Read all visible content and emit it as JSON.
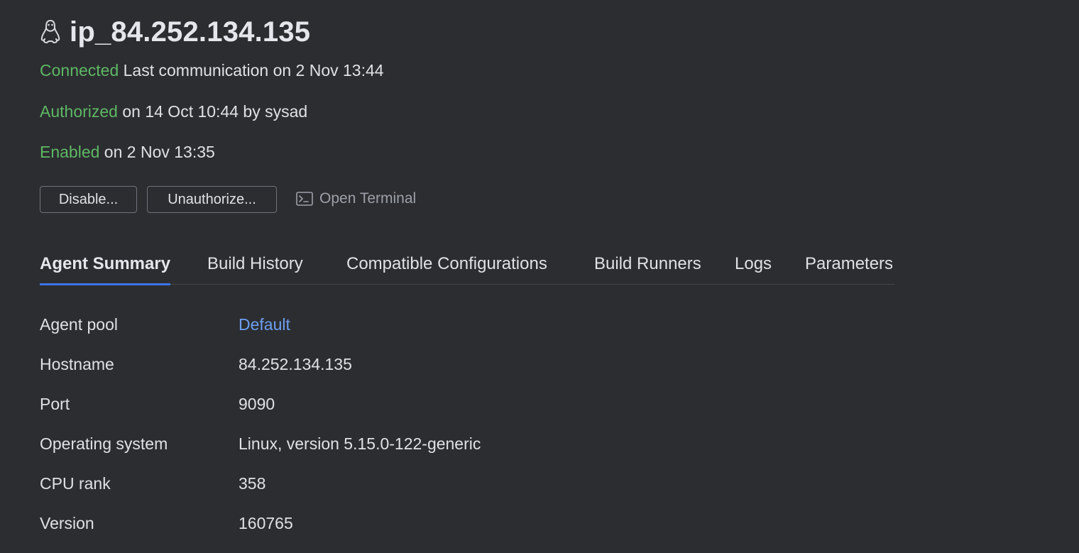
{
  "agent": {
    "title": "ip_84.252.134.135",
    "os_icon": "linux-tux-icon"
  },
  "status": {
    "connected_label": "Connected",
    "connected_text": " Last communication on 2 Nov 13:44",
    "authorized_label": "Authorized",
    "authorized_text": " on 14 Oct 10:44 by sysad",
    "enabled_label": "Enabled",
    "enabled_text": " on 2 Nov 13:35",
    "ok_color": "#5fb865"
  },
  "actions": {
    "disable_label": "Disable...",
    "unauthorize_label": "Unauthorize...",
    "terminal_label": "Open Terminal",
    "terminal_icon": "terminal-icon"
  },
  "tabs": [
    {
      "label": "Agent Summary",
      "active": true
    },
    {
      "label": "Build History",
      "active": false
    },
    {
      "label": "Compatible Configurations",
      "active": false
    },
    {
      "label": "Build Runners",
      "active": false
    },
    {
      "label": "Logs",
      "active": false
    },
    {
      "label": "Parameters",
      "active": false
    }
  ],
  "details": [
    {
      "label": "Agent pool",
      "value": "Default"
    },
    {
      "label": "Hostname",
      "value": "84.252.134.135"
    },
    {
      "label": "Port",
      "value": "9090"
    },
    {
      "label": "Operating system",
      "value": "Linux, version 5.15.0-122-generic"
    },
    {
      "label": "CPU rank",
      "value": "358"
    },
    {
      "label": "Version",
      "value": "160765"
    }
  ],
  "colors": {
    "background": "#2b2d30",
    "accent": "#3d74e8",
    "link": "#6d9ef0"
  }
}
